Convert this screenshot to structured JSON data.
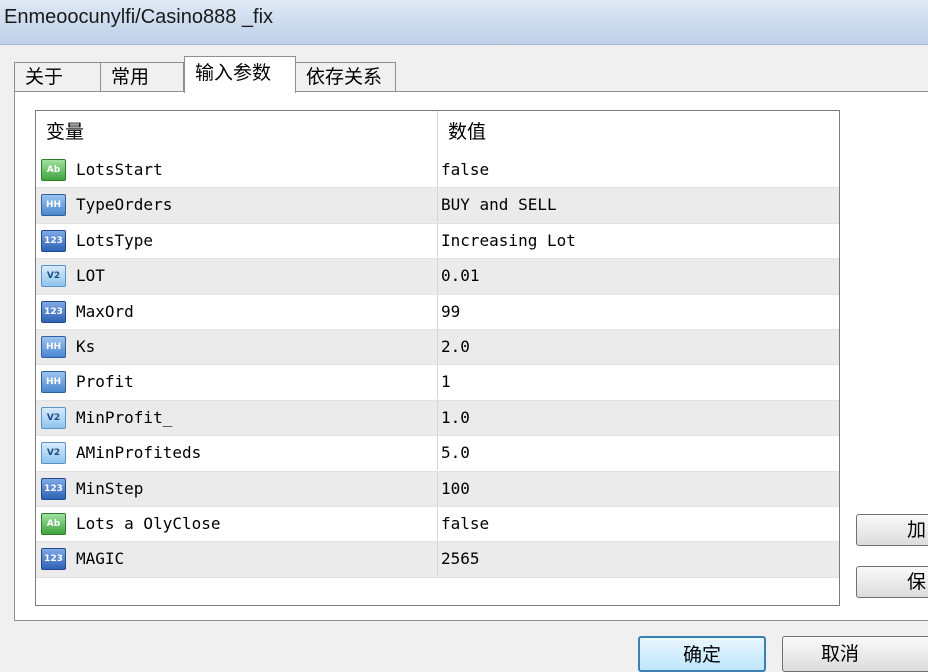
{
  "window": {
    "title": "Enmeoocunylfi/Casino888 _fix"
  },
  "tabs": [
    {
      "label": "关于",
      "active": false
    },
    {
      "label": "常用",
      "active": false
    },
    {
      "label": "输入参数",
      "active": true
    },
    {
      "label": "依存关系",
      "active": false
    }
  ],
  "grid": {
    "header": {
      "variable": "变量",
      "value": "数值"
    },
    "rows": [
      {
        "type": "bool-icon",
        "icon_text": "Ab",
        "name": "LotsStart",
        "value": "false"
      },
      {
        "type": "enum-icon",
        "icon_text": "HH",
        "name": "TypeOrders",
        "value": "BUY and SELL"
      },
      {
        "type": "int-icon",
        "icon_text": "123",
        "name": "LotsType",
        "value": "Increasing Lot"
      },
      {
        "type": "double-icon",
        "icon_text": "V2",
        "name": "LOT",
        "value": "0.01"
      },
      {
        "type": "int-icon",
        "icon_text": "123",
        "name": "MaxOrd",
        "value": "99"
      },
      {
        "type": "enum-icon",
        "icon_text": "HH",
        "name": "Ks",
        "value": "2.0"
      },
      {
        "type": "enum-icon",
        "icon_text": "HH",
        "name": "Profit",
        "value": "1"
      },
      {
        "type": "double-icon",
        "icon_text": "V2",
        "name": "MinProfit_",
        "value": "1.0"
      },
      {
        "type": "double-icon",
        "icon_text": "V2",
        "name": "AMinProfiteds",
        "value": "5.0"
      },
      {
        "type": "int-icon",
        "icon_text": "123",
        "name": "MinStep",
        "value": "100"
      },
      {
        "type": "bool-icon",
        "icon_text": "Ab",
        "name": "Lots  a OlyClose",
        "value": "false"
      },
      {
        "type": "int-icon",
        "icon_text": "123",
        "name": "MAGIC",
        "value": "2565"
      }
    ]
  },
  "side_buttons": {
    "load_label": "加",
    "save_label": "保"
  },
  "footer": {
    "ok_label": "确定",
    "cancel_label": "取消"
  }
}
